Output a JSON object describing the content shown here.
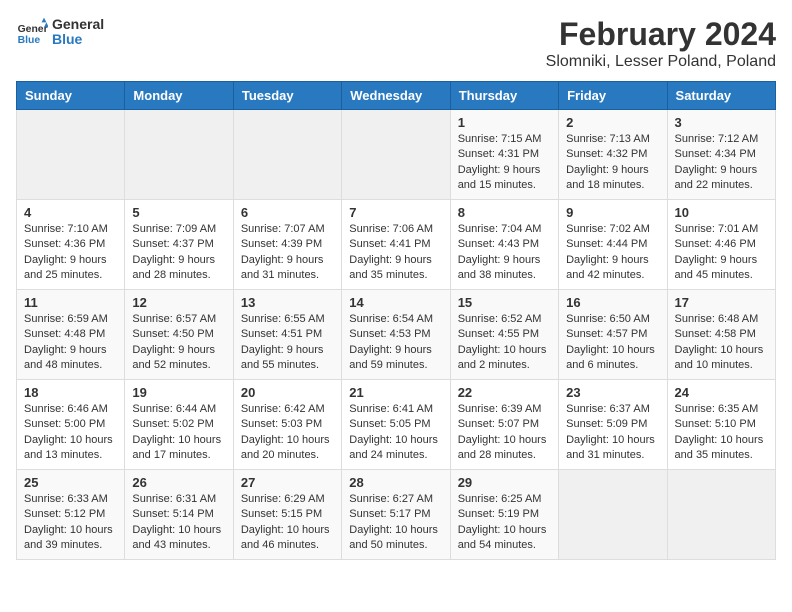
{
  "header": {
    "logo_line1": "General",
    "logo_line2": "Blue",
    "title": "February 2024",
    "subtitle": "Slomniki, Lesser Poland, Poland"
  },
  "days_of_week": [
    "Sunday",
    "Monday",
    "Tuesday",
    "Wednesday",
    "Thursday",
    "Friday",
    "Saturday"
  ],
  "weeks": [
    [
      {
        "day": "",
        "info": ""
      },
      {
        "day": "",
        "info": ""
      },
      {
        "day": "",
        "info": ""
      },
      {
        "day": "",
        "info": ""
      },
      {
        "day": "1",
        "info": "Sunrise: 7:15 AM\nSunset: 4:31 PM\nDaylight: 9 hours\nand 15 minutes."
      },
      {
        "day": "2",
        "info": "Sunrise: 7:13 AM\nSunset: 4:32 PM\nDaylight: 9 hours\nand 18 minutes."
      },
      {
        "day": "3",
        "info": "Sunrise: 7:12 AM\nSunset: 4:34 PM\nDaylight: 9 hours\nand 22 minutes."
      }
    ],
    [
      {
        "day": "4",
        "info": "Sunrise: 7:10 AM\nSunset: 4:36 PM\nDaylight: 9 hours\nand 25 minutes."
      },
      {
        "day": "5",
        "info": "Sunrise: 7:09 AM\nSunset: 4:37 PM\nDaylight: 9 hours\nand 28 minutes."
      },
      {
        "day": "6",
        "info": "Sunrise: 7:07 AM\nSunset: 4:39 PM\nDaylight: 9 hours\nand 31 minutes."
      },
      {
        "day": "7",
        "info": "Sunrise: 7:06 AM\nSunset: 4:41 PM\nDaylight: 9 hours\nand 35 minutes."
      },
      {
        "day": "8",
        "info": "Sunrise: 7:04 AM\nSunset: 4:43 PM\nDaylight: 9 hours\nand 38 minutes."
      },
      {
        "day": "9",
        "info": "Sunrise: 7:02 AM\nSunset: 4:44 PM\nDaylight: 9 hours\nand 42 minutes."
      },
      {
        "day": "10",
        "info": "Sunrise: 7:01 AM\nSunset: 4:46 PM\nDaylight: 9 hours\nand 45 minutes."
      }
    ],
    [
      {
        "day": "11",
        "info": "Sunrise: 6:59 AM\nSunset: 4:48 PM\nDaylight: 9 hours\nand 48 minutes."
      },
      {
        "day": "12",
        "info": "Sunrise: 6:57 AM\nSunset: 4:50 PM\nDaylight: 9 hours\nand 52 minutes."
      },
      {
        "day": "13",
        "info": "Sunrise: 6:55 AM\nSunset: 4:51 PM\nDaylight: 9 hours\nand 55 minutes."
      },
      {
        "day": "14",
        "info": "Sunrise: 6:54 AM\nSunset: 4:53 PM\nDaylight: 9 hours\nand 59 minutes."
      },
      {
        "day": "15",
        "info": "Sunrise: 6:52 AM\nSunset: 4:55 PM\nDaylight: 10 hours\nand 2 minutes."
      },
      {
        "day": "16",
        "info": "Sunrise: 6:50 AM\nSunset: 4:57 PM\nDaylight: 10 hours\nand 6 minutes."
      },
      {
        "day": "17",
        "info": "Sunrise: 6:48 AM\nSunset: 4:58 PM\nDaylight: 10 hours\nand 10 minutes."
      }
    ],
    [
      {
        "day": "18",
        "info": "Sunrise: 6:46 AM\nSunset: 5:00 PM\nDaylight: 10 hours\nand 13 minutes."
      },
      {
        "day": "19",
        "info": "Sunrise: 6:44 AM\nSunset: 5:02 PM\nDaylight: 10 hours\nand 17 minutes."
      },
      {
        "day": "20",
        "info": "Sunrise: 6:42 AM\nSunset: 5:03 PM\nDaylight: 10 hours\nand 20 minutes."
      },
      {
        "day": "21",
        "info": "Sunrise: 6:41 AM\nSunset: 5:05 PM\nDaylight: 10 hours\nand 24 minutes."
      },
      {
        "day": "22",
        "info": "Sunrise: 6:39 AM\nSunset: 5:07 PM\nDaylight: 10 hours\nand 28 minutes."
      },
      {
        "day": "23",
        "info": "Sunrise: 6:37 AM\nSunset: 5:09 PM\nDaylight: 10 hours\nand 31 minutes."
      },
      {
        "day": "24",
        "info": "Sunrise: 6:35 AM\nSunset: 5:10 PM\nDaylight: 10 hours\nand 35 minutes."
      }
    ],
    [
      {
        "day": "25",
        "info": "Sunrise: 6:33 AM\nSunset: 5:12 PM\nDaylight: 10 hours\nand 39 minutes."
      },
      {
        "day": "26",
        "info": "Sunrise: 6:31 AM\nSunset: 5:14 PM\nDaylight: 10 hours\nand 43 minutes."
      },
      {
        "day": "27",
        "info": "Sunrise: 6:29 AM\nSunset: 5:15 PM\nDaylight: 10 hours\nand 46 minutes."
      },
      {
        "day": "28",
        "info": "Sunrise: 6:27 AM\nSunset: 5:17 PM\nDaylight: 10 hours\nand 50 minutes."
      },
      {
        "day": "29",
        "info": "Sunrise: 6:25 AM\nSunset: 5:19 PM\nDaylight: 10 hours\nand 54 minutes."
      },
      {
        "day": "",
        "info": ""
      },
      {
        "day": "",
        "info": ""
      }
    ]
  ]
}
